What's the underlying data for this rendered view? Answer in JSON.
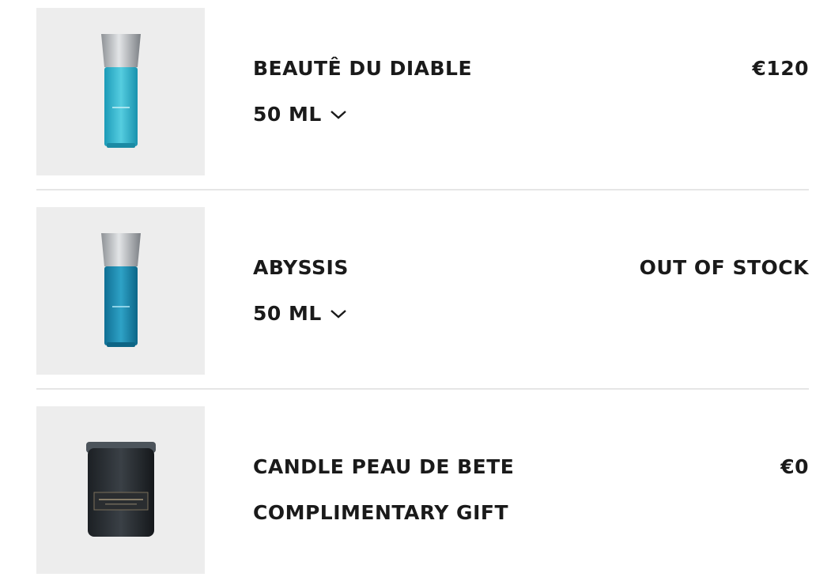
{
  "items": [
    {
      "name": "BEAUTÊ DU DIABLE",
      "detail": "50 ML",
      "price": "€120",
      "image_icon": "perfume-bottle-light-blue-icon",
      "liquid_color": "#2fb6cf"
    },
    {
      "name": "ABYSSIS",
      "detail": "50 ML",
      "price": "OUT OF STOCK",
      "image_icon": "perfume-bottle-deep-blue-icon",
      "liquid_color": "#1b87ad"
    },
    {
      "name": "CANDLE PEAU DE BETE",
      "detail": "COMPLIMENTARY GIFT",
      "price": "€0",
      "image_icon": "candle-jar-icon",
      "liquid_color": "#2b2f33"
    }
  ]
}
